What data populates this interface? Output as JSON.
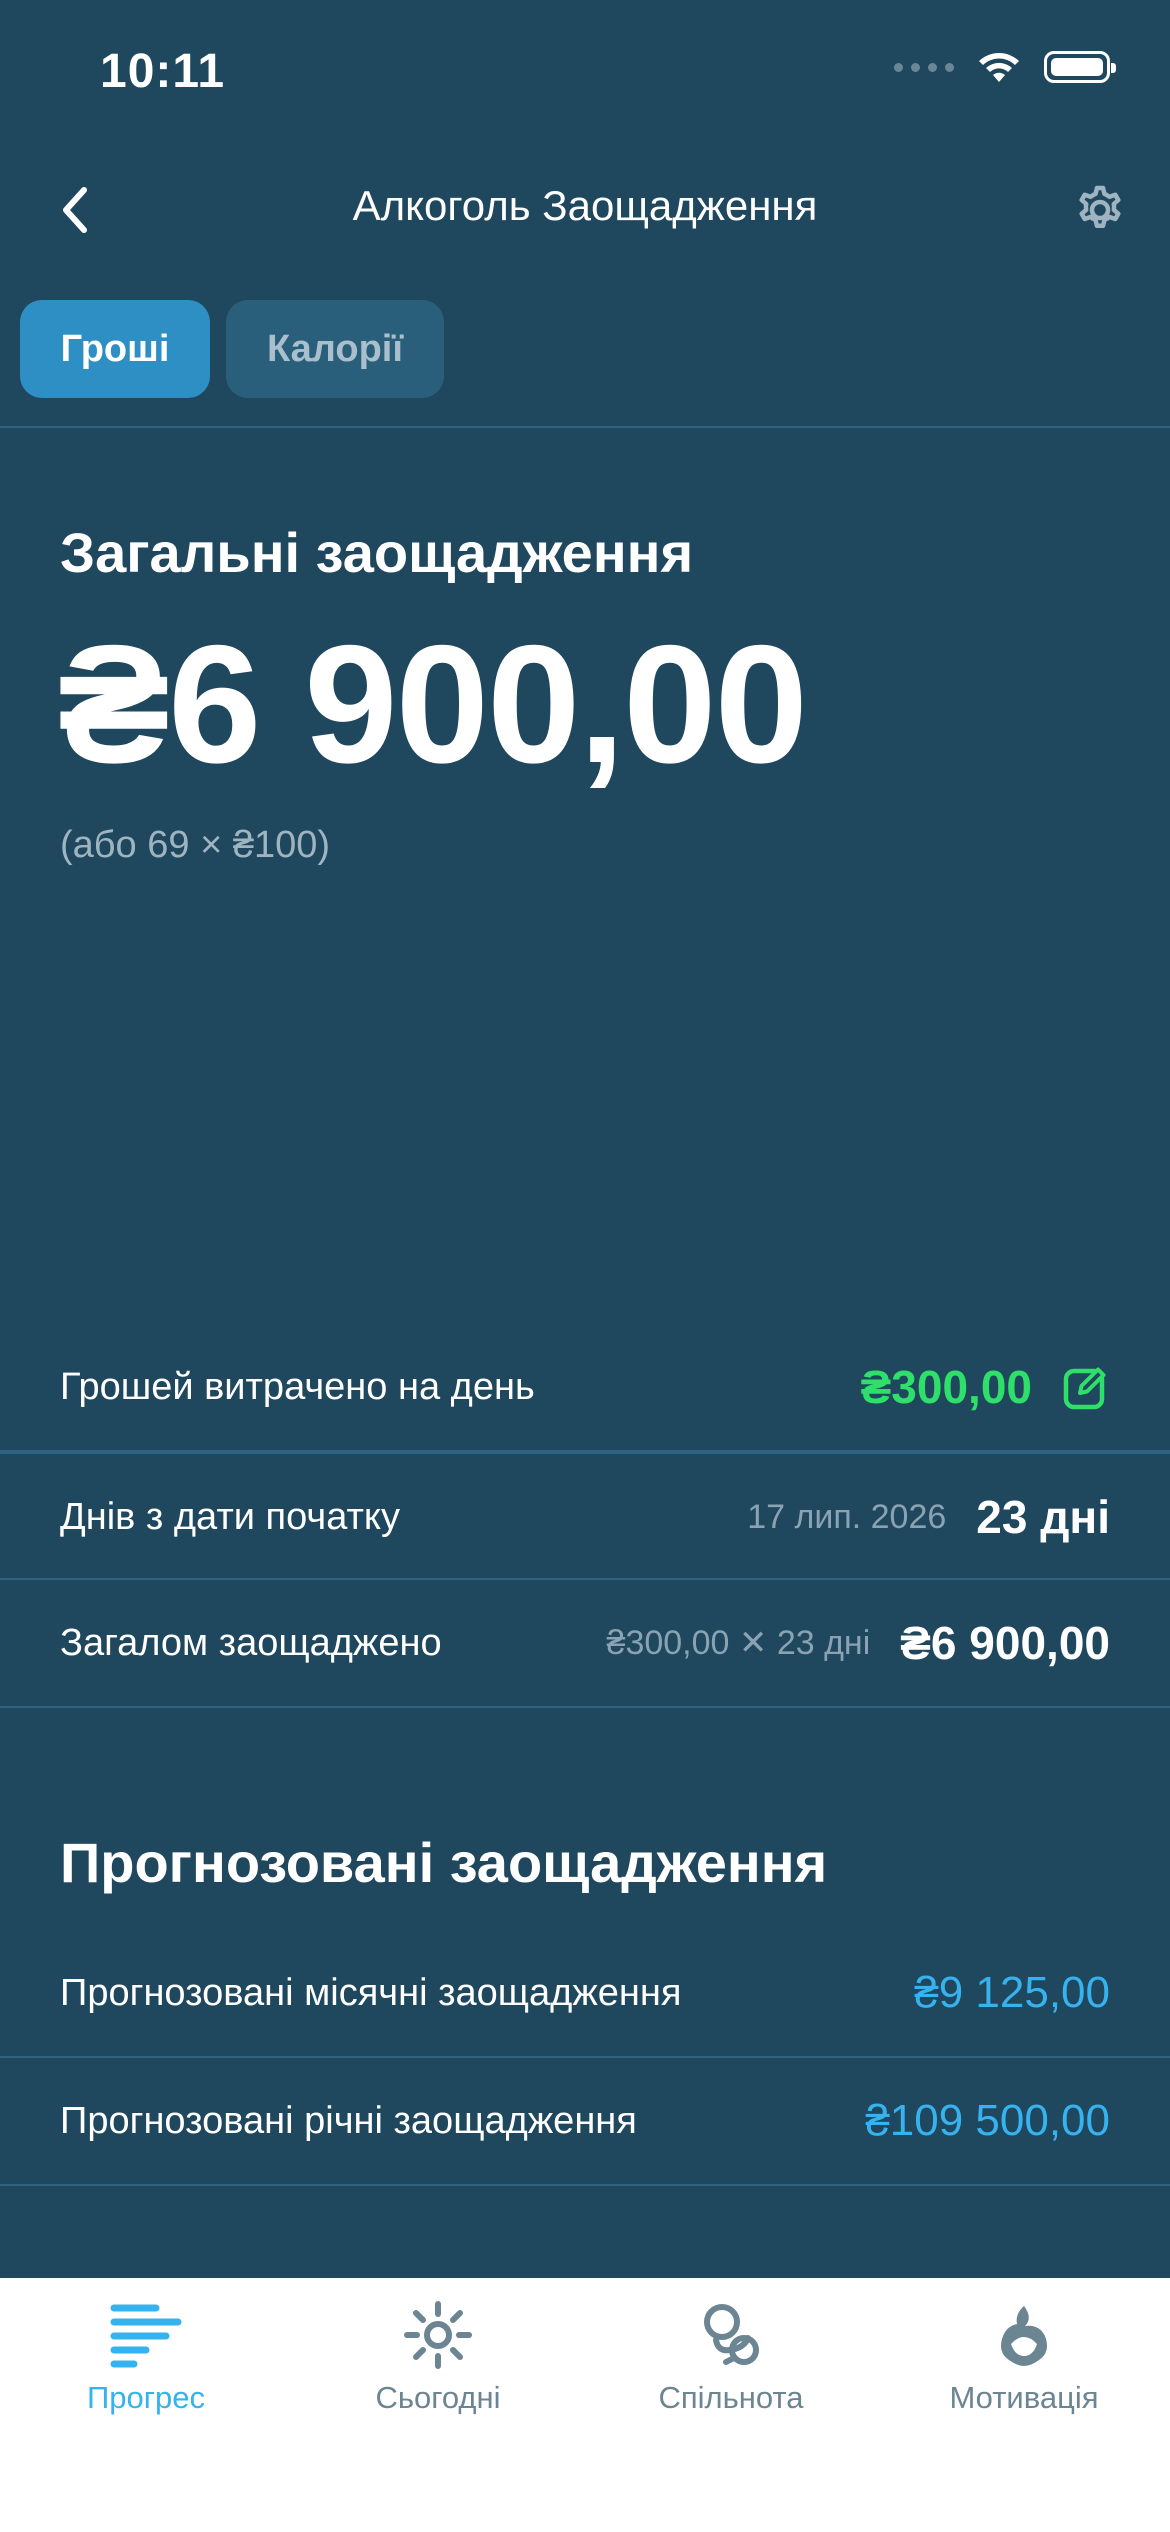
{
  "status_bar": {
    "time": "10:11"
  },
  "header": {
    "title": "Алкоголь Заощадження",
    "back_icon": "chevron-left-icon",
    "settings_icon": "gear-icon"
  },
  "tabs": [
    {
      "label": "Гроші",
      "active": true
    },
    {
      "label": "Калорії",
      "active": false
    }
  ],
  "summary": {
    "title": "Загальні заощадження",
    "amount": "₴6 900,00",
    "hint": "(або 69 × ₴100)"
  },
  "details": {
    "daily_spend": {
      "label": "Грошей витрачено на день",
      "value": "₴300,00"
    },
    "days": {
      "label": "Днів з дати початку",
      "date": "17 лип. 2026",
      "value": "23 дні"
    },
    "total_saved": {
      "label": "Загалом заощаджено",
      "formula": "₴300,00 ✕ 23 дні",
      "value": "₴6 900,00"
    }
  },
  "forecast": {
    "title": "Прогнозовані заощадження",
    "monthly": {
      "label": "Прогнозовані місячні заощадження",
      "value": "₴9 125,00"
    },
    "yearly": {
      "label": "Прогнозовані річні заощадження",
      "value": "₴109 500,00"
    }
  },
  "bottom_nav": [
    {
      "label": "Прогрес",
      "icon": "progress-icon",
      "active": true
    },
    {
      "label": "Сьогодні",
      "icon": "sun-icon",
      "active": false
    },
    {
      "label": "Спільнота",
      "icon": "community-icon",
      "active": false
    },
    {
      "label": "Мотивація",
      "icon": "motivation-icon",
      "active": false
    }
  ],
  "colors": {
    "background": "#1f475d",
    "accent": "#2d8fc4",
    "green": "#2ee06a",
    "blue": "#36b2ee"
  }
}
